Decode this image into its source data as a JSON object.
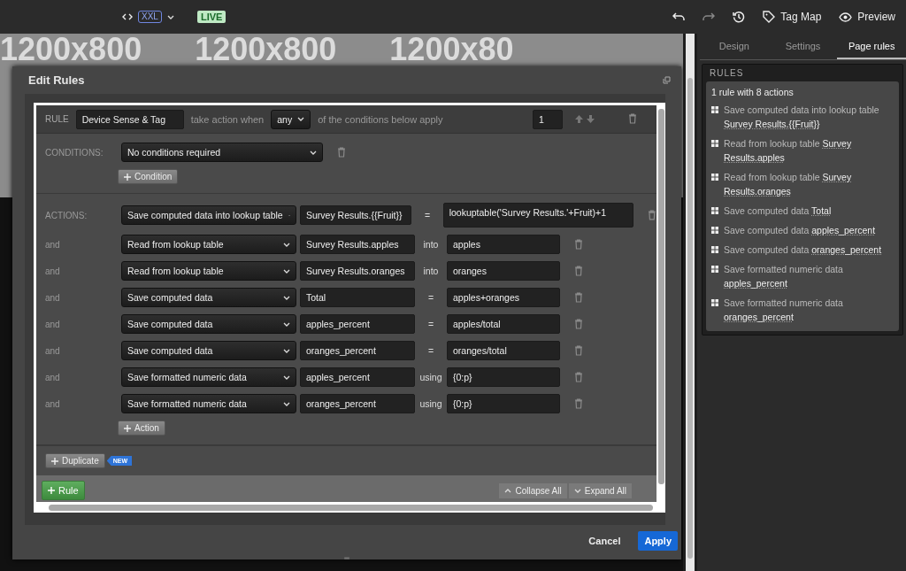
{
  "topbar": {
    "size_badge": "XXL",
    "live_badge": "LIVE",
    "buttons": [
      {
        "label": "Tag Map",
        "kind": "tag"
      },
      {
        "label": "Preview",
        "kind": "eye"
      }
    ]
  },
  "canvas": {
    "placeholders": [
      "1200x800",
      "1200x800",
      "1200x80"
    ]
  },
  "dialog": {
    "title": "Edit Rules",
    "rule": {
      "label": "RULE",
      "name": "Device Sense & Tag",
      "when_text": "take action when",
      "match": "any",
      "apply_text": "of the conditions below apply",
      "order": "1"
    },
    "conditions": {
      "label": "CONDITIONS:",
      "value": "No conditions required",
      "add_button": "Condition"
    },
    "actions": {
      "rows": [
        {
          "joiner": "ACTIONS:",
          "type": "Save computed data into lookup table",
          "target": "Survey Results.{{Fruit}}",
          "operator": "=",
          "value": "lookuptable('Survey Results.'+Fruit)+1"
        },
        {
          "joiner": "and",
          "type": "Read from lookup table",
          "target": "Survey Results.apples",
          "operator": "into",
          "value": "apples"
        },
        {
          "joiner": "and",
          "type": "Read from lookup table",
          "target": "Survey Results.oranges",
          "operator": "into",
          "value": "oranges"
        },
        {
          "joiner": "and",
          "type": "Save computed data",
          "target": "Total",
          "operator": "=",
          "value": "apples+oranges"
        },
        {
          "joiner": "and",
          "type": "Save computed data",
          "target": "apples_percent",
          "operator": "=",
          "value": "apples/total"
        },
        {
          "joiner": "and",
          "type": "Save computed data",
          "target": "oranges_percent",
          "operator": "=",
          "value": "oranges/total"
        },
        {
          "joiner": "and",
          "type": "Save formatted numeric data",
          "target": "apples_percent",
          "operator": "using",
          "value": "{0:p}"
        },
        {
          "joiner": "and",
          "type": "Save formatted numeric data",
          "target": "oranges_percent",
          "operator": "using",
          "value": "{0:p}"
        }
      ],
      "add_button": "Action"
    },
    "duplicate_button": "Duplicate",
    "new_badge": "NEW",
    "add_rule_button": "Rule",
    "collapse_all": "Collapse All",
    "expand_all": "Expand All",
    "cancel": "Cancel",
    "apply": "Apply"
  },
  "side_panel": {
    "tabs": [
      {
        "label": "Design",
        "selected": false
      },
      {
        "label": "Settings",
        "selected": false
      },
      {
        "label": "Page rules",
        "selected": true
      }
    ],
    "rules_heading": "RULES",
    "summary": "1 rule with 8 actions",
    "items": [
      {
        "text": "Save computed data into lookup table",
        "target": "Survey Results.{{Fruit}}"
      },
      {
        "text": "Read from lookup table",
        "target": "Survey Results.apples"
      },
      {
        "text": "Read from lookup table",
        "target": "Survey Results.oranges"
      },
      {
        "text": "Save computed data",
        "target": "Total"
      },
      {
        "text": "Save computed data",
        "target": "apples_percent"
      },
      {
        "text": "Save computed data",
        "target": "oranges_percent"
      },
      {
        "text": "Save formatted numeric data",
        "target": "apples_percent"
      },
      {
        "text": "Save formatted numeric data",
        "target": "oranges_percent"
      }
    ]
  }
}
